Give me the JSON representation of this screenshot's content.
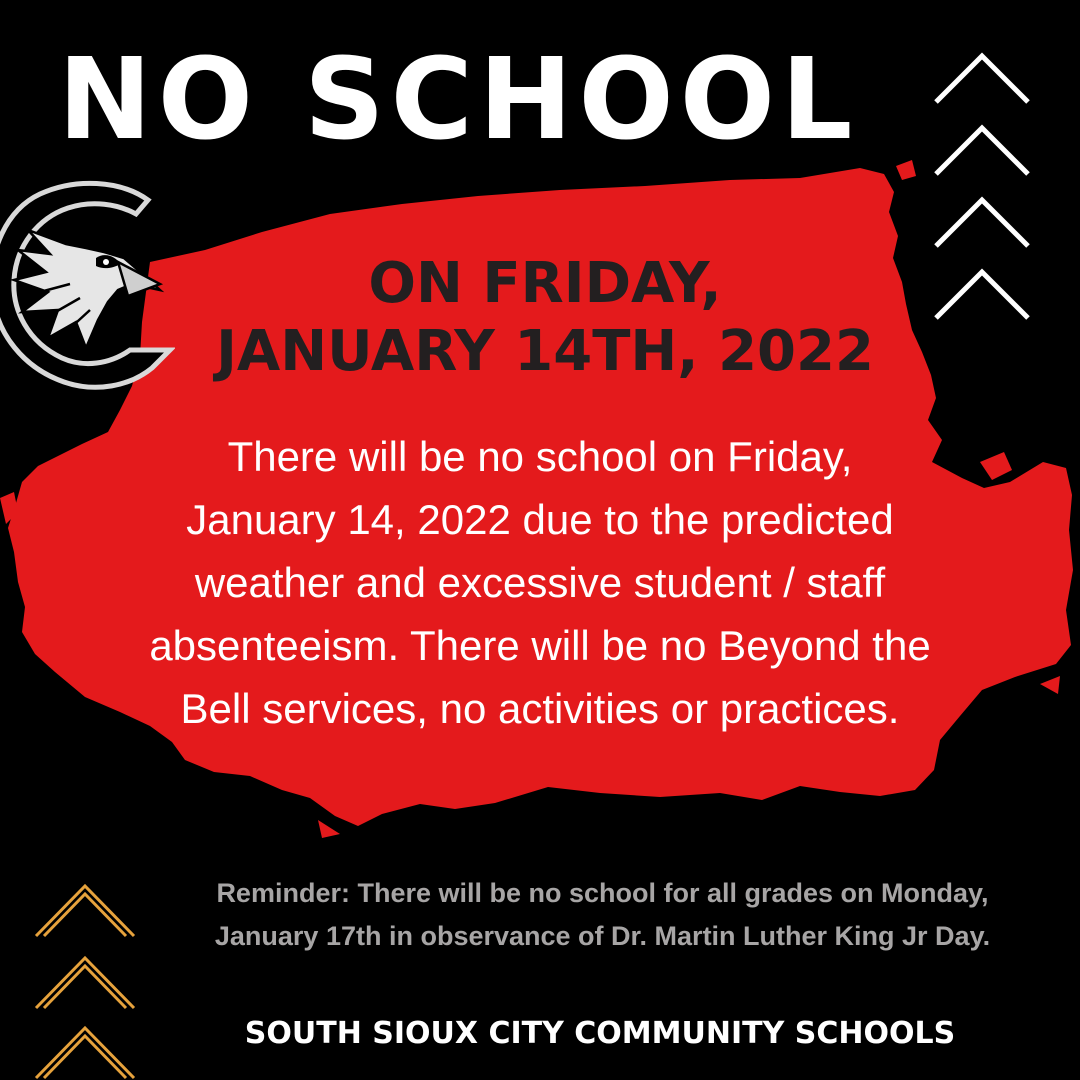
{
  "colors": {
    "background": "#000000",
    "splash_red": "#e41a1c",
    "title_text": "#ffffff",
    "date_text": "#231f20",
    "reminder_text": "#a7a5a5",
    "top_chevrons": "#ffffff",
    "bottom_chevrons": "#e6a23c"
  },
  "icons": {
    "logo": "cardinal-mascot-logo",
    "top_decoration": "up-chevron-stack",
    "bottom_decoration": "up-chevron-stack"
  },
  "title": "NO SCHOOL",
  "date_lines": [
    "ON FRIDAY,",
    "JANUARY 14TH, 2022"
  ],
  "body_lines": [
    "There will be no school on Friday,",
    "January 14, 2022 due to the predicted",
    "weather and excessive student / staff",
    "absenteeism. There will be no Beyond the",
    "Bell services, no activities or practices."
  ],
  "reminder_lines": [
    "Reminder: There will be no school for all grades on Monday,",
    "January 17th in observance of Dr. Martin Luther King Jr Day."
  ],
  "footer": "SOUTH SIOUX CITY COMMUNITY SCHOOLS"
}
